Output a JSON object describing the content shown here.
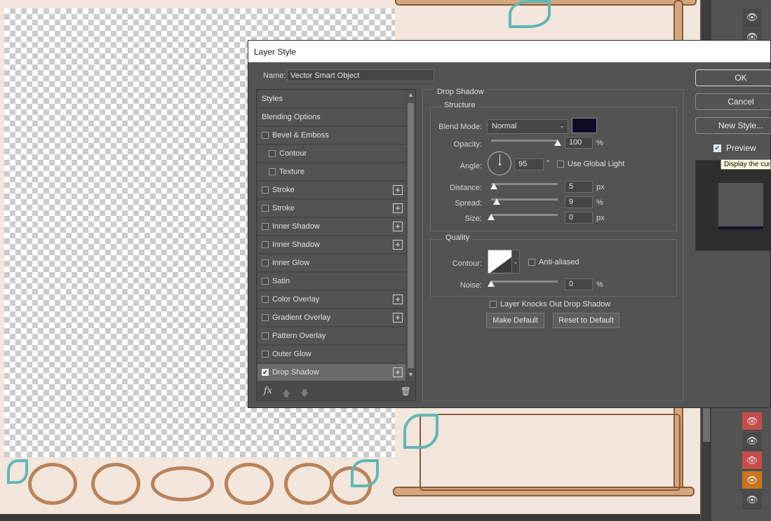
{
  "dialog": {
    "title": "Layer Style",
    "name_label": "Name:",
    "name_value": "Vector Smart Object"
  },
  "styles_list": [
    {
      "label": "Styles",
      "checkbox": false,
      "checked": false,
      "plus": false,
      "sub": false
    },
    {
      "label": "Blending Options",
      "checkbox": false,
      "checked": false,
      "plus": false,
      "sub": false
    },
    {
      "label": "Bevel & Emboss",
      "checkbox": true,
      "checked": false,
      "plus": false,
      "sub": false
    },
    {
      "label": "Contour",
      "checkbox": true,
      "checked": false,
      "plus": false,
      "sub": true
    },
    {
      "label": "Texture",
      "checkbox": true,
      "checked": false,
      "plus": false,
      "sub": true
    },
    {
      "label": "Stroke",
      "checkbox": true,
      "checked": false,
      "plus": true,
      "sub": false
    },
    {
      "label": "Stroke",
      "checkbox": true,
      "checked": false,
      "plus": true,
      "sub": false
    },
    {
      "label": "Inner Shadow",
      "checkbox": true,
      "checked": false,
      "plus": true,
      "sub": false
    },
    {
      "label": "Inner Shadow",
      "checkbox": true,
      "checked": false,
      "plus": true,
      "sub": false
    },
    {
      "label": "Inner Glow",
      "checkbox": true,
      "checked": false,
      "plus": false,
      "sub": false
    },
    {
      "label": "Satin",
      "checkbox": true,
      "checked": false,
      "plus": false,
      "sub": false
    },
    {
      "label": "Color Overlay",
      "checkbox": true,
      "checked": false,
      "plus": true,
      "sub": false
    },
    {
      "label": "Gradient Overlay",
      "checkbox": true,
      "checked": false,
      "plus": true,
      "sub": false
    },
    {
      "label": "Pattern Overlay",
      "checkbox": true,
      "checked": false,
      "plus": false,
      "sub": false
    },
    {
      "label": "Outer Glow",
      "checkbox": true,
      "checked": false,
      "plus": false,
      "sub": false
    },
    {
      "label": "Drop Shadow",
      "checkbox": true,
      "checked": true,
      "plus": true,
      "sub": false,
      "selected": true
    }
  ],
  "footer": {
    "fx_label": "fx",
    "up_icon": "arrow-up-icon",
    "down_icon": "arrow-down-icon",
    "trash_icon": "trash-icon"
  },
  "drop_shadow": {
    "title": "Drop Shadow",
    "structure_title": "Structure",
    "blend_mode_label": "Blend Mode:",
    "blend_mode_value": "Normal",
    "shadow_color": "#0e0b25",
    "opacity_label": "Opacity:",
    "opacity_value": "100",
    "opacity_unit": "%",
    "angle_label": "Angle:",
    "angle_value": "95",
    "angle_unit": "°",
    "use_global_light_label": "Use Global Light",
    "distance_label": "Distance:",
    "distance_value": "5",
    "distance_unit": "px",
    "spread_label": "Spread:",
    "spread_value": "9",
    "spread_unit": "%",
    "size_label": "Size:",
    "size_value": "0",
    "size_unit": "px",
    "quality_title": "Quality",
    "contour_label": "Contour:",
    "anti_aliased_label": "Anti-aliased",
    "noise_label": "Noise:",
    "noise_value": "0",
    "noise_unit": "%",
    "knocks_out_label": "Layer Knocks Out Drop Shadow",
    "make_default_label": "Make Default",
    "reset_default_label": "Reset to Default"
  },
  "actions": {
    "ok_label": "OK",
    "cancel_label": "Cancel",
    "new_style_label": "New Style...",
    "preview_label": "Preview",
    "preview_checked": true
  },
  "tooltip": {
    "text": "Display the cur"
  },
  "layers_panel": {
    "eye_icon": "eye-icon"
  }
}
